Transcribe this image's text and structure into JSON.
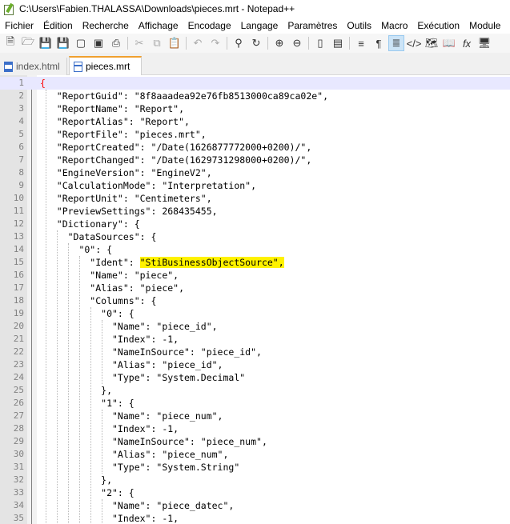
{
  "window": {
    "title": "C:\\Users\\Fabien.THALASSA\\Downloads\\pieces.mrt - Notepad++"
  },
  "menu": [
    "Fichier",
    "Édition",
    "Recherche",
    "Affichage",
    "Encodage",
    "Langage",
    "Paramètres",
    "Outils",
    "Macro",
    "Exécution",
    "Module"
  ],
  "tabs": [
    {
      "label": "index.html",
      "active": false
    },
    {
      "label": "pieces.mrt",
      "active": true
    }
  ],
  "editor": {
    "lines": [
      "{",
      "   \"ReportGuid\": \"8f8aaadea92e76fb8513000ca89ca02e\",",
      "   \"ReportName\": \"Report\",",
      "   \"ReportAlias\": \"Report\",",
      "   \"ReportFile\": \"pieces.mrt\",",
      "   \"ReportCreated\": \"/Date(1626877772000+0200)/\",",
      "   \"ReportChanged\": \"/Date(1629731298000+0200)/\",",
      "   \"EngineVersion\": \"EngineV2\",",
      "   \"CalculationMode\": \"Interpretation\",",
      "   \"ReportUnit\": \"Centimeters\",",
      "   \"PreviewSettings\": 268435455,",
      "   \"Dictionary\": {",
      "     \"DataSources\": {",
      "       \"0\": {",
      "         \"Ident\": ",
      "         \"Name\": \"piece\",",
      "         \"Alias\": \"piece\",",
      "         \"Columns\": {",
      "           \"0\": {",
      "             \"Name\": \"piece_id\",",
      "             \"Index\": -1,",
      "             \"NameInSource\": \"piece_id\",",
      "             \"Alias\": \"piece_id\",",
      "             \"Type\": \"System.Decimal\"",
      "           },",
      "           \"1\": {",
      "             \"Name\": \"piece_num\",",
      "             \"Index\": -1,",
      "             \"NameInSource\": \"piece_num\",",
      "             \"Alias\": \"piece_num\",",
      "             \"Type\": \"System.String\"",
      "           },",
      "           \"2\": {",
      "             \"Name\": \"piece_datec\",",
      "             \"Index\": -1,"
    ],
    "highlight_text": "\"StiBusinessObjectSource\",",
    "highlight_color": "#fff200",
    "current_line_color": "#e8e8ff"
  },
  "toolbar_icons": [
    "new-file-icon",
    "open-file-icon",
    "save-icon",
    "save-all-icon",
    "close-icon",
    "close-all-icon",
    "print-icon",
    "cut-icon",
    "copy-icon",
    "paste-icon",
    "undo-icon",
    "redo-icon",
    "find-icon",
    "replace-icon",
    "zoom-in-icon",
    "zoom-out-icon",
    "sync-scroll-icon",
    "wrap-icon",
    "word-wrap-icon",
    "show-all-chars-icon",
    "indent-guide-icon",
    "xml-tag-icon",
    "doc-map-icon",
    "function-list-icon",
    "fx-icon",
    "monitor-icon"
  ]
}
